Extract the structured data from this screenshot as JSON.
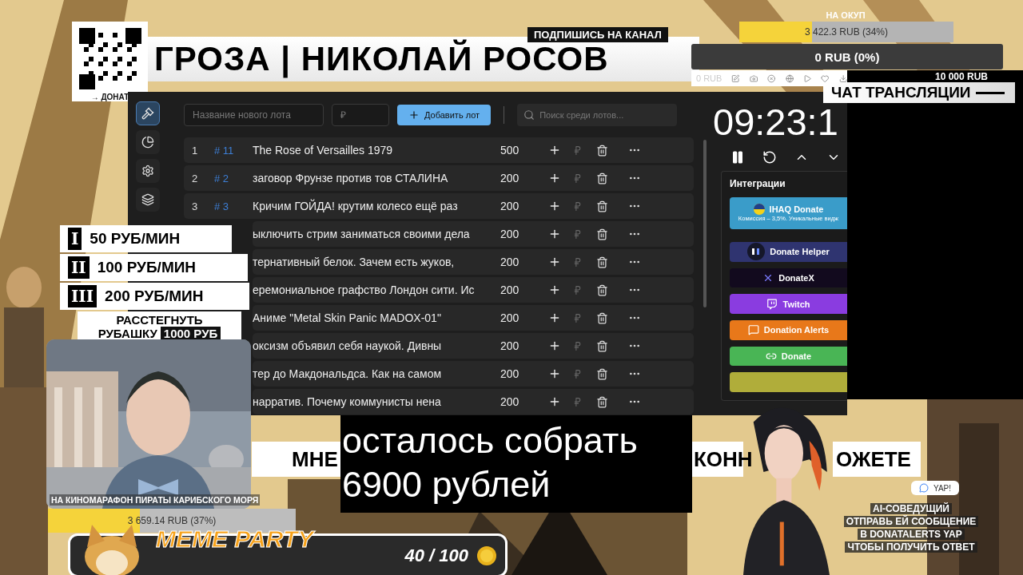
{
  "donate_qr": {
    "caption": "→ ДОНАТ"
  },
  "header": {
    "title": "ГРОЗА | НИКОЛАЙ РОСОВ",
    "subscribe": "ПОДПИШИСЬ НА КАНАЛ"
  },
  "goal": {
    "title": "НА ОКУП",
    "bar": {
      "reading": "3 422.3 RUB (34%)",
      "level": 0.34
    },
    "main_bar": {
      "reading": "0 RUB (0%)",
      "level": 0
    },
    "start": "0 RUB",
    "target": "10 000 RUB"
  },
  "chat": {
    "title": "ЧАТ ТРАНСЛЯЦИИ"
  },
  "auction": {
    "sidebar": [
      {
        "selected": true
      },
      {
        "selected": false
      },
      {
        "selected": false
      },
      {
        "selected": false
      }
    ],
    "new_lot": {
      "placeholder": "Название нового лота"
    },
    "price": {
      "placeholder": "₽"
    },
    "add_button": "Добавить лот",
    "search": {
      "placeholder": "Поиск среди лотов..."
    },
    "lots": [
      {
        "number": "1",
        "tag": "# 11",
        "title": "The Rose of Versailles 1979",
        "amount": "500"
      },
      {
        "number": "2",
        "tag": "# 2",
        "title": "заговор Фрунзе против тов СТАЛИНА",
        "amount": "200"
      },
      {
        "number": "3",
        "tag": "# 3",
        "title": "Кричим ГОЙДА! крутим колесо ещё раз",
        "amount": "200"
      },
      {
        "title": "ыключить стрим заниматься своими дела",
        "amount": "200"
      },
      {
        "title": "тернативный белок. Зачем есть жуков,",
        "amount": "200"
      },
      {
        "title": "еремониальное графство Лондон сити. Ис",
        "amount": "200"
      },
      {
        "title": "Аниме \"Metal Skin Panic MADOX-01\"",
        "amount": "200"
      },
      {
        "title": "оксизм объявил себя наукой. Дивны",
        "amount": "200"
      },
      {
        "title": "тер до Макдональдса. Как на самом",
        "amount": "200"
      },
      {
        "title": "нарратив. Почему коммунисты нена",
        "amount": "200"
      }
    ],
    "timer": "09:23:1",
    "integrations": {
      "title": "Интеграции",
      "items": [
        {
          "label": "IHAQ Donate",
          "note": "Комиссия – 3,5%. Уникальные видж",
          "color": "#3a9cc9"
        },
        {
          "label": "Donate Helper",
          "color": "#2f3470"
        },
        {
          "label": "DonateX",
          "color": "#120a1e"
        },
        {
          "label": "Twitch",
          "color": "#8a3ce0"
        },
        {
          "label": "Donation Alerts",
          "color": "#e8781a"
        },
        {
          "label": "Donate",
          "color": "#49b555"
        },
        {
          "color": "#b0ad3a"
        }
      ]
    }
  },
  "rates": {
    "items": [
      {
        "numeral": "I",
        "text": "50 РУБ/МИН"
      },
      {
        "numeral": "II",
        "text": "100 РУБ/МИН"
      },
      {
        "numeral": "III",
        "text": "200 РУБ/МИН"
      }
    ],
    "unbutton": {
      "line1": "РАССТЕГНУТЬ",
      "line2": "РУБАШКУ",
      "price": "1000 РУБ"
    }
  },
  "webcam": {
    "caption": "НА КИНОМАРАФОН ПИРАТЫ КАРИБСКОГО МОРЯ",
    "bar": {
      "reading": "3 659.14 RUB (37%)",
      "level": 0.37
    }
  },
  "meme": {
    "title": "MEME PARTY",
    "count": "40 / 100"
  },
  "ticker": [
    "МНЕ",
    "КОНН",
    "ОЖЕТЕ"
  ],
  "subtitle": "осталось собрать 6900 рублей",
  "cohost": {
    "badge": "YAP!",
    "title": "AI-СОВЕДУЩИЙ",
    "lines": [
      "ОТПРАВЬ ЕЙ СООБЩЕНИЕ",
      "В DONATALERTS  YAP",
      "ЧТОБЫ ПОЛУЧИТЬ ОТВЕТ"
    ]
  }
}
